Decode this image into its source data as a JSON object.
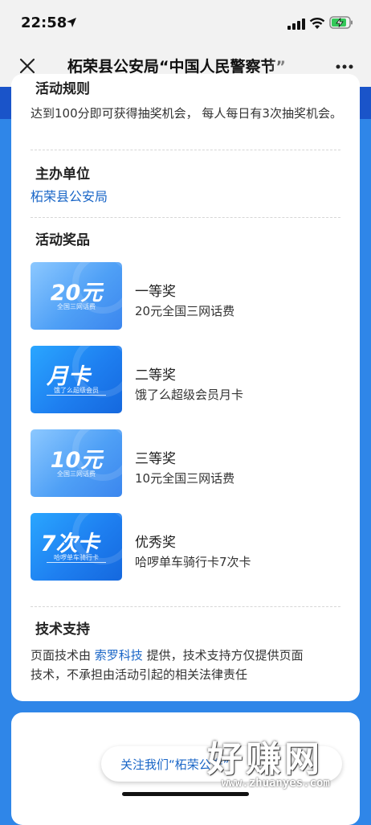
{
  "status_bar": {
    "time": "22:58"
  },
  "nav": {
    "title": "柘荣县公安局“中国人民警察节”"
  },
  "rules": {
    "heading": "活动规则",
    "text": "达到100分即可获得抽奖机会， 每人每日有3次抽奖机会。"
  },
  "organizer": {
    "heading": "主办单位",
    "name": "柘荣县公安局"
  },
  "prizes": {
    "heading": "活动奖品",
    "items": [
      {
        "image_main": "20元",
        "image_sub": "全国三网话费",
        "name": "一等奖",
        "desc": "20元全国三网话费"
      },
      {
        "image_main": "月卡",
        "image_sub": "饿了么超级会员",
        "name": "二等奖",
        "desc": "饿了么超级会员月卡"
      },
      {
        "image_main": "10元",
        "image_sub": "全国三网话费",
        "name": "三等奖",
        "desc": "10元全国三网话费"
      },
      {
        "image_main": "7次卡",
        "image_sub": "哈啰单车骑行卡",
        "name": "优秀奖",
        "desc": "哈啰单车骑行卡7次卡"
      }
    ]
  },
  "tech": {
    "heading": "技术支持",
    "prefix": "页面技术由",
    "company": "索罗科技",
    "suffix": "提供，技术支持方仅提供页面",
    "line2": "技术，不承担由活动引起的相关法律责任"
  },
  "follow": {
    "label": "关注我们“柘荣公安”"
  },
  "watermark": {
    "big": "好赚网",
    "small": "www.zhuanyes.com"
  },
  "colors": {
    "accent": "#1a66c7",
    "background": "#2f86e8"
  }
}
